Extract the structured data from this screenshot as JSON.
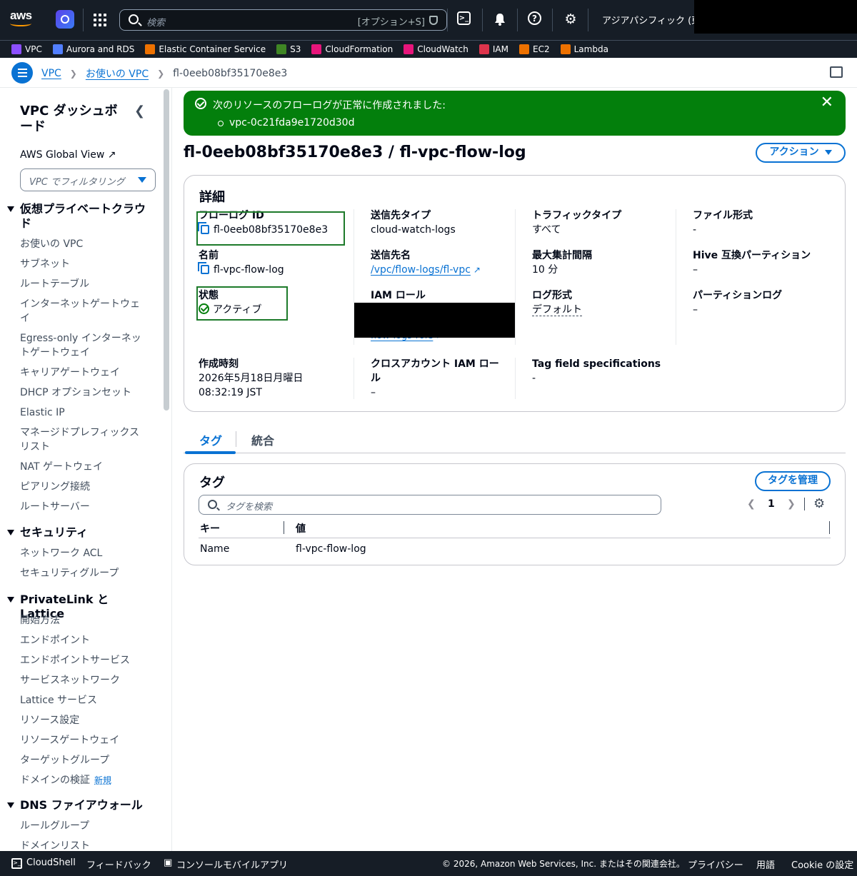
{
  "topnav": {
    "logo": "aws",
    "search_placeholder": "検索",
    "search_shortcut": "[オプション+S]",
    "region": "アジアパシフィック (東京)"
  },
  "favorites": [
    {
      "label": "VPC",
      "color": "#8c4fff"
    },
    {
      "label": "Aurora and RDS",
      "color": "#527fff"
    },
    {
      "label": "Elastic Container Service",
      "color": "#ed7100"
    },
    {
      "label": "S3",
      "color": "#3f8624"
    },
    {
      "label": "CloudFormation",
      "color": "#e7157b"
    },
    {
      "label": "CloudWatch",
      "color": "#e7157b"
    },
    {
      "label": "IAM",
      "color": "#dd344c"
    },
    {
      "label": "EC2",
      "color": "#ed7100"
    },
    {
      "label": "Lambda",
      "color": "#ed7100"
    }
  ],
  "breadcrumb": {
    "items": [
      "VPC",
      "お使いの VPC"
    ],
    "current": "fl-0eeb08bf35170e8e3"
  },
  "sidebar": {
    "title": "VPC ダッシュボード",
    "global_view": "AWS Global View",
    "filter_placeholder": "VPC でフィルタリング",
    "sections": [
      {
        "title": "仮想プライベートクラウド",
        "items": [
          "お使いの VPC",
          "サブネット",
          "ルートテーブル",
          "インターネットゲートウェイ",
          "Egress-only インターネットゲートウェイ",
          "キャリアゲートウェイ",
          "DHCP オプションセット",
          "Elastic IP",
          "マネージドプレフィックスリスト",
          "NAT ゲートウェイ",
          "ピアリング接続",
          "ルートサーバー"
        ]
      },
      {
        "title": "セキュリティ",
        "items": [
          "ネットワーク ACL",
          "セキュリティグループ"
        ]
      },
      {
        "title": "PrivateLink と Lattice",
        "items": [
          "開始方法",
          "エンドポイント",
          "エンドポイントサービス",
          "サービスネットワーク",
          "Lattice サービス",
          "リソース設定",
          "リソースゲートウェイ",
          "ターゲットグループ",
          "ドメインの検証"
        ],
        "new_badge": "新規"
      },
      {
        "title": "DNS ファイアウォール",
        "items": [
          "ルールグループ",
          "ドメインリスト"
        ]
      }
    ]
  },
  "flash": {
    "message": "次のリソースのフローログが正常に作成されました:",
    "resource": "vpc-0c21fda9e1720d30d"
  },
  "page": {
    "title": "fl-0eeb08bf35170e8e3 / fl-vpc-flow-log",
    "actions_label": "アクション"
  },
  "details": {
    "heading": "詳細",
    "flow_log_id": {
      "label": "フローログ ID",
      "value": "fl-0eeb08bf35170e8e3"
    },
    "name": {
      "label": "名前",
      "value": "fl-vpc-flow-log"
    },
    "state": {
      "label": "状態",
      "value": "アクティブ"
    },
    "created": {
      "label": "作成時刻",
      "value_date": "2026年5月18日月曜日",
      "value_time": "08:32:19 JST"
    },
    "dest_type": {
      "label": "送信先タイプ",
      "value": "cloud-watch-logs"
    },
    "dest_name": {
      "label": "送信先名",
      "value": "/vpc/flow-logs/fl-vpc"
    },
    "iam_role": {
      "label": "IAM ロール",
      "value_visible": "flow-logs-role"
    },
    "cross_account": {
      "label": "クロスアカウント IAM ロール",
      "value": "–"
    },
    "traffic_type": {
      "label": "トラフィックタイプ",
      "value": "すべて"
    },
    "max_interval": {
      "label": "最大集計間隔",
      "value": "10 分"
    },
    "log_format": {
      "label": "ログ形式",
      "value": "デフォルト"
    },
    "tag_field": {
      "label": "Tag field specifications",
      "value": "-"
    },
    "file_format": {
      "label": "ファイル形式",
      "value": "-"
    },
    "hive": {
      "label": "Hive 互換パーティション",
      "value": "–"
    },
    "partition": {
      "label": "パーティションログ",
      "value": "–"
    }
  },
  "tabs": [
    "タグ",
    "統合"
  ],
  "tags": {
    "heading": "タグ",
    "manage_label": "タグを管理",
    "search_placeholder": "タグを検索",
    "page": "1",
    "columns": [
      "キー",
      "値"
    ],
    "rows": [
      {
        "key": "Name",
        "value": "fl-vpc-flow-log"
      }
    ]
  },
  "footer": {
    "cloudshell": "CloudShell",
    "feedback": "フィードバック",
    "mobile": "コンソールモバイルアプリ",
    "copyright": "© 2026, Amazon Web Services, Inc. またはその関連会社。",
    "privacy": "プライバシー",
    "terms": "用語",
    "cookie": "Cookie の設定"
  }
}
